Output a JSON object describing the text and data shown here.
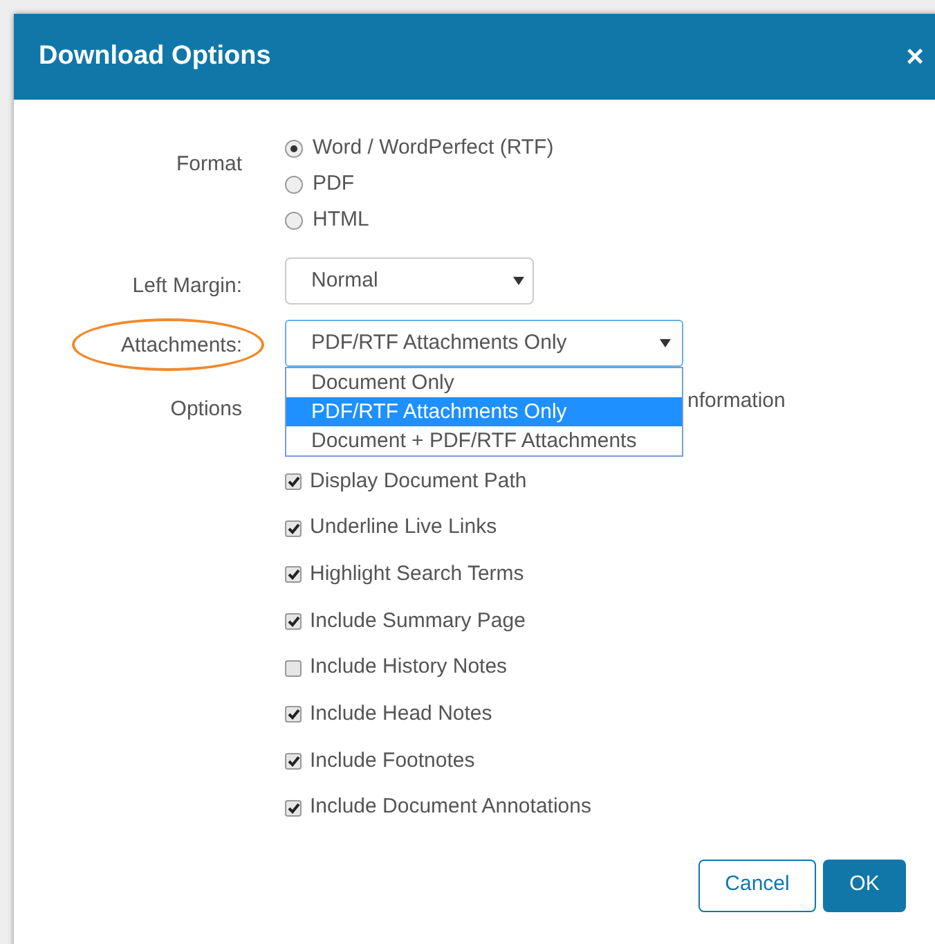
{
  "dialog": {
    "title": "Download Options",
    "close": "×"
  },
  "format": {
    "label": "Format",
    "choices": [
      {
        "label": "Word / WordPerfect (RTF)",
        "selected": true
      },
      {
        "label": "PDF",
        "selected": false
      },
      {
        "label": "HTML",
        "selected": false
      }
    ]
  },
  "left_margin": {
    "label": "Left Margin:",
    "value": "Normal"
  },
  "attachments": {
    "label": "Attachments:",
    "highlighted": true,
    "value": "PDF/RTF Attachments Only",
    "expanded": true,
    "options": [
      {
        "label": "Document Only",
        "selected": false
      },
      {
        "label": "PDF/RTF Attachments Only",
        "selected": true
      },
      {
        "label": "Document + PDF/RTF Attachments",
        "selected": false
      }
    ]
  },
  "options": {
    "label": "Options",
    "covered_text": "nformation",
    "items": [
      {
        "label": "Display Document Path",
        "checked": true
      },
      {
        "label": "Underline Live Links",
        "checked": true
      },
      {
        "label": "Highlight Search Terms",
        "checked": true
      },
      {
        "label": "Include Summary Page",
        "checked": true
      },
      {
        "label": "Include History Notes",
        "checked": false
      },
      {
        "label": "Include Head Notes",
        "checked": true
      },
      {
        "label": "Include Footnotes",
        "checked": true
      },
      {
        "label": "Include Document Annotations",
        "checked": true
      }
    ]
  },
  "buttons": [
    {
      "label": "Cancel",
      "kind": "secondary"
    },
    {
      "label": "OK",
      "kind": "primary"
    }
  ]
}
